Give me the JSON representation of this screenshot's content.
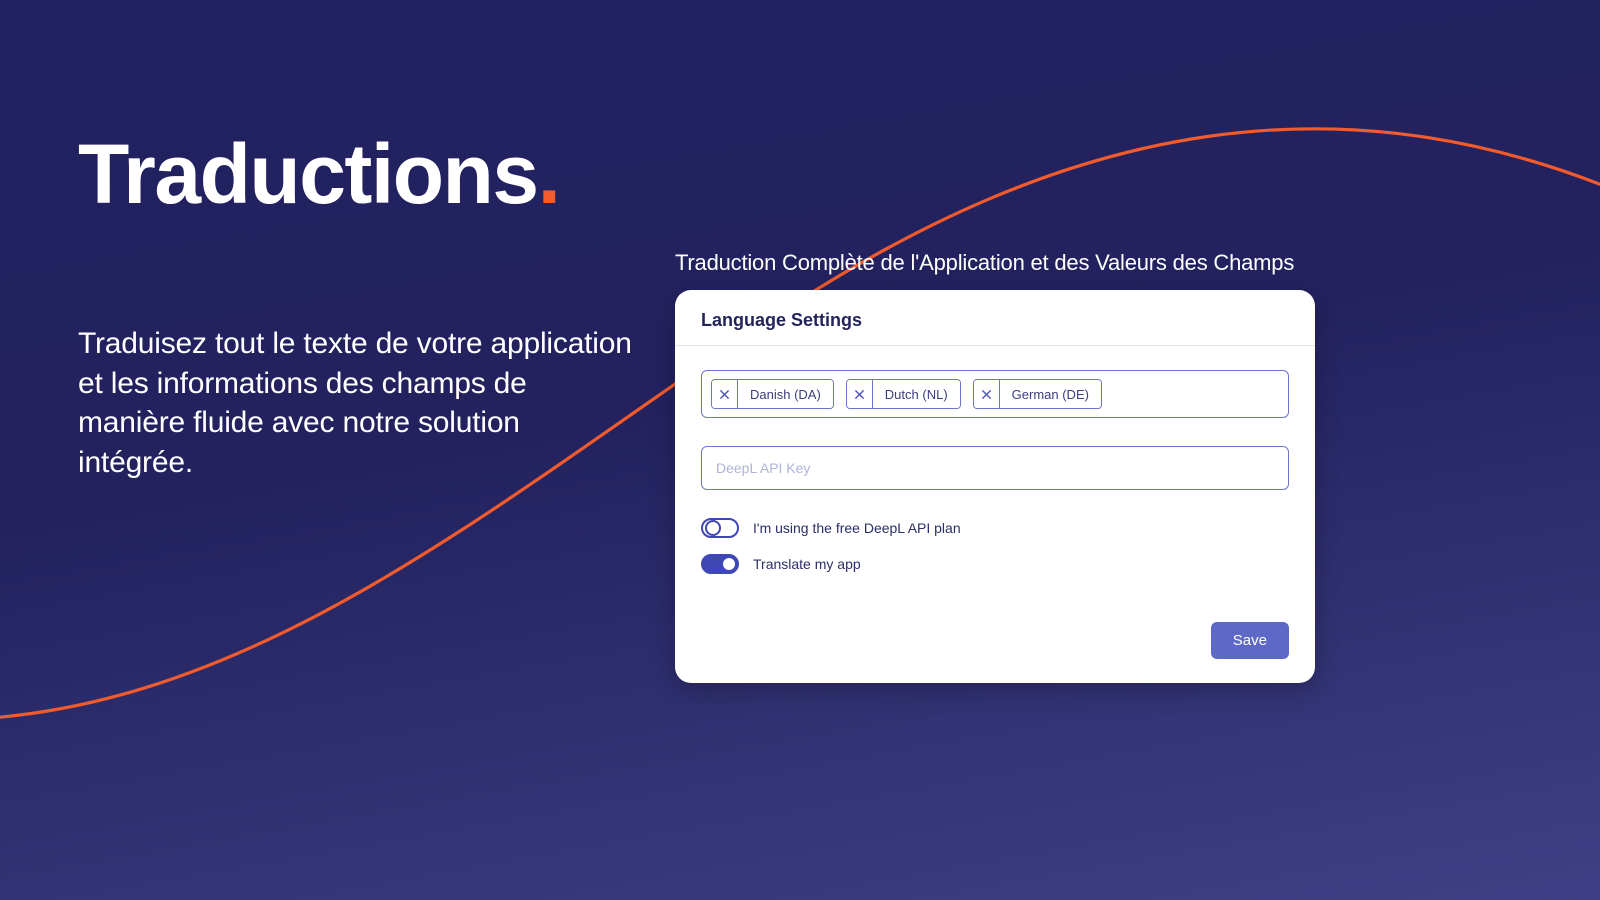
{
  "colors": {
    "accent": "#f35b2c",
    "primary": "#3f46b5",
    "bg_top": "#222160",
    "bg_bottom": "#3f3f85"
  },
  "hero": {
    "title": "Traductions",
    "dot": ".",
    "blurb": "Traduisez tout le texte de votre application et les informations des champs de manière fluide avec notre solution intégrée."
  },
  "panel": {
    "subtitle": "Traduction Complète de l'Application et des Valeurs des Champs",
    "card_title": "Language Settings",
    "chips": [
      {
        "label": "Danish (DA)"
      },
      {
        "label": "Dutch (NL)"
      },
      {
        "label": "German (DE)"
      }
    ],
    "api_key_placeholder": "DeepL API Key",
    "api_key_value": "",
    "toggle_free_plan": {
      "label": "I'm using the free DeepL API plan",
      "on": false
    },
    "toggle_translate_app": {
      "label": "Translate my app",
      "on": true
    },
    "save_label": "Save"
  }
}
